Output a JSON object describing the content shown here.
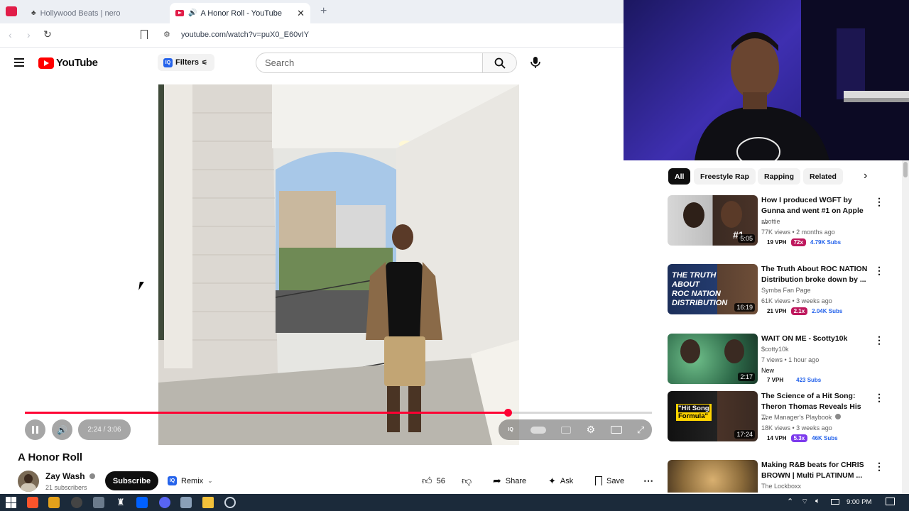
{
  "browser": {
    "tabs": [
      {
        "title": "Hollywood Beats | nero"
      },
      {
        "title": "A Honor Roll - YouTube"
      }
    ],
    "url": "youtube.com/watch?v=puX0_E60vIY"
  },
  "yt": {
    "logo_text": "YouTube",
    "filters_label": "Filters",
    "search_placeholder": "Search"
  },
  "player": {
    "time": "2:24 / 3:06",
    "progress": 0.77
  },
  "video": {
    "title": "A Honor Roll",
    "channel": "Zay Wash",
    "subscribers": "21 subscribers",
    "subscribe_label": "Subscribe",
    "remix_label": "Remix",
    "likes": "56",
    "share_label": "Share",
    "ask_label": "Ask",
    "save_label": "Save"
  },
  "chips": [
    "All",
    "Freestyle Rap",
    "Rapping",
    "Related"
  ],
  "recommendations": [
    {
      "title": "How I produced WGFT by Gunna and went #1 on Apple ...",
      "channel": "shottie",
      "meta": "77K views • 2 months ago",
      "new": "",
      "vph": "19 VPH",
      "mult": "72x",
      "mult_color": "#be185d",
      "subs": "4.79K Subs",
      "duration": "5:05"
    },
    {
      "title": "The Truth About ROC NATION Distribution broke down by ...",
      "channel": "Symba Fan Page",
      "meta": "61K views • 3 weeks ago",
      "new": "",
      "vph": "21 VPH",
      "mult": "2.1x",
      "mult_color": "#be185d",
      "subs": "2.04K Subs",
      "duration": "16:19"
    },
    {
      "title": "WAIT ON ME - $cotty10k",
      "channel": "$cotty10k",
      "meta": "7 views • 1 hour ago",
      "new": "New",
      "vph": "7 VPH",
      "mult": "",
      "mult_color": "",
      "subs": "423 Subs",
      "duration": "2:17"
    },
    {
      "title": "The Science of a Hit Song: Theron Thomas Reveals His ...",
      "channel": "The Manager's Playbook",
      "meta": "18K views • 3 weeks ago",
      "new": "",
      "vph": "14 VPH",
      "mult": "5.3x",
      "mult_color": "#7c3aed",
      "subs": "46K Subs",
      "duration": "17:24"
    },
    {
      "title": "Making R&B beats for CHRIS BROWN | Multi PLATINUM ...",
      "channel": "The Lockboxx",
      "meta": "",
      "new": "",
      "vph": "",
      "mult": "",
      "mult_color": "",
      "subs": "",
      "duration": ""
    }
  ],
  "thumb_text": {
    "rec0_badge": "#1",
    "rec1_lines": [
      "THE TRUTH",
      "ABOUT",
      "ROC NATION",
      "DISTRIBUTION"
    ],
    "rec3_lines": [
      "\"Hit Song",
      "Formula\""
    ]
  },
  "taskbar": {
    "time": "9:00 PM"
  }
}
